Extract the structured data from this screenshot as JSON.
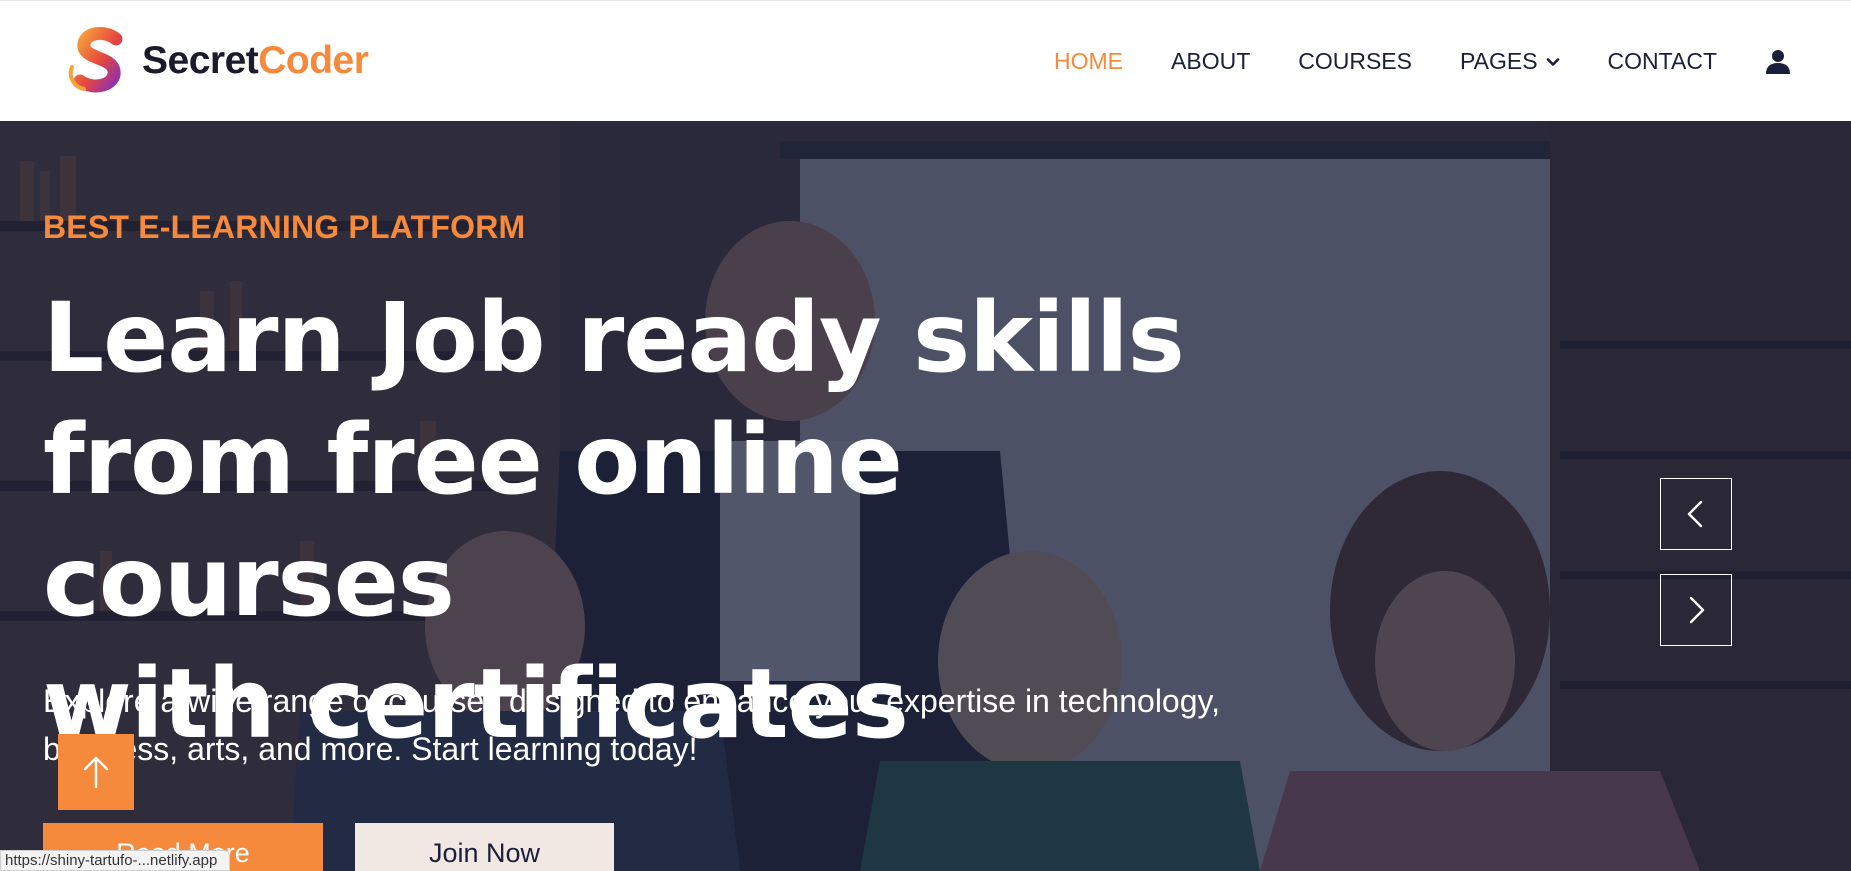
{
  "brand": {
    "name_part1": "Secret",
    "name_part2": "Coder",
    "accent_color": "#f68a3c",
    "logo_icon": "s-logo-icon"
  },
  "nav": {
    "items": [
      {
        "label": "HOME",
        "active": true
      },
      {
        "label": "ABOUT"
      },
      {
        "label": "COURSES"
      },
      {
        "label": "PAGES",
        "icon": "chevron-down-icon"
      },
      {
        "label": "CONTACT"
      }
    ],
    "user_icon": "user-icon"
  },
  "hero": {
    "eyebrow": "BEST E-LEARNING PLATFORM",
    "headline_line1": "Learn Job ready skills",
    "headline_line2": "from free online courses",
    "headline_line3": "with certificates",
    "subtext_line1": "Explore a wide range of courses designed to enhance your expertise in technology,",
    "subtext_line2": "business, arts, and more. Start learning today!",
    "primary_button": "Read More",
    "secondary_button": "Join Now",
    "prev_icon": "chevron-left-icon",
    "next_icon": "chevron-right-icon"
  },
  "back_to_top_icon": "arrow-up-icon",
  "status_bar": {
    "url": "https://shiny-tartufo-...netlify.app"
  }
}
